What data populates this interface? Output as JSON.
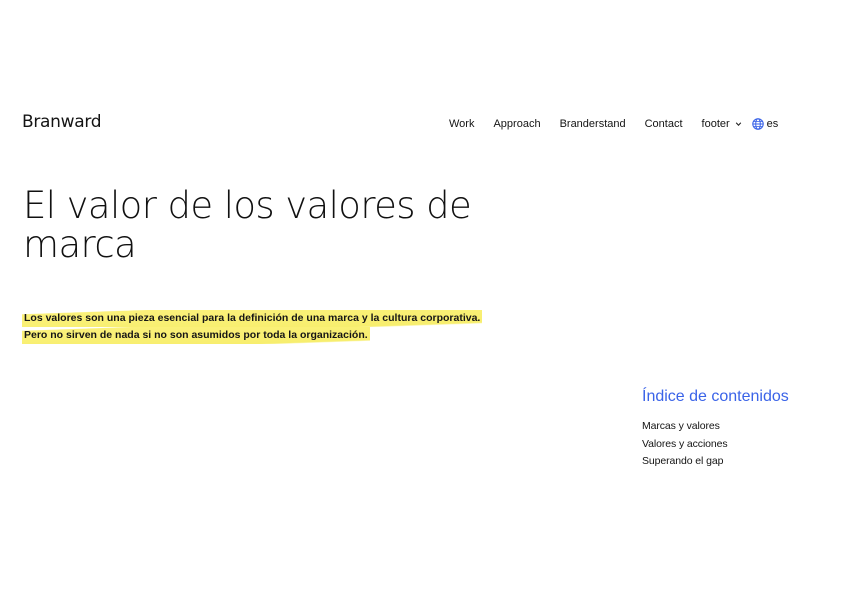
{
  "header": {
    "logo": "Branward",
    "nav": {
      "work": "Work",
      "approach": "Approach",
      "branderstand": "Branderstand",
      "contact": "Contact",
      "footer": "footer"
    },
    "language": "es"
  },
  "article": {
    "title": "El valor de los valores de marca",
    "lead": "Los valores son una pieza esencial para la definición de una marca y la cultura corporativa. Pero no sirven de nada si no son asumidos por toda la organización."
  },
  "toc": {
    "title": "Índice de contenidos",
    "items": [
      "Marcas y valores",
      "Valores y acciones",
      "Superando el gap"
    ]
  },
  "colors": {
    "accent": "#3a63e8",
    "highlight": "#f7ee6e",
    "text": "#111111"
  },
  "icons": [
    "chevron-down-icon",
    "globe-icon"
  ]
}
